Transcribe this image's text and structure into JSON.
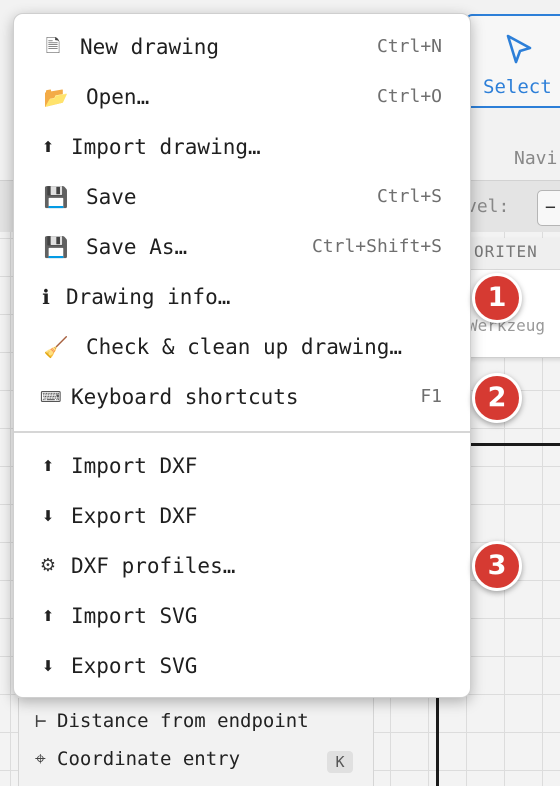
{
  "background": {
    "select_tool": {
      "label": "Select",
      "icon": "cursor-arrow-icon",
      "color": "#2d7fd8"
    },
    "navi_label": "Navi",
    "level_label": "vel:",
    "level_button": "−",
    "favorites_header": "ORITEN",
    "favorites_text": "Werkzeug",
    "bottom_panel": [
      {
        "icon": "⊢",
        "label": "Distance from endpoint",
        "key": ""
      },
      {
        "icon": "⌖",
        "label": "Coordinate entry",
        "key": "K"
      }
    ]
  },
  "badges": [
    "1",
    "2",
    "3"
  ],
  "badge_color": "#d63a32",
  "menu": {
    "group1": [
      {
        "icon": "🗎",
        "icon_name": "document-icon",
        "label": "New drawing",
        "shortcut": "Ctrl+N"
      },
      {
        "icon": "📂",
        "icon_name": "folder-open-icon",
        "label": "Open…",
        "shortcut": "Ctrl+O"
      },
      {
        "icon": "⬆",
        "icon_name": "upload-arrow-icon",
        "label": "Import drawing…",
        "shortcut": ""
      },
      {
        "icon": "💾",
        "icon_name": "floppy-disk-icon",
        "label": "Save",
        "shortcut": "Ctrl+S"
      },
      {
        "icon": "💾",
        "icon_name": "floppy-disk-icon",
        "label": "Save As…",
        "shortcut": "Ctrl+Shift+S"
      },
      {
        "icon": "ℹ",
        "icon_name": "info-icon",
        "label": "Drawing info…",
        "shortcut": ""
      },
      {
        "icon": "🧹",
        "icon_name": "broom-icon",
        "label": "Check & clean up drawing…",
        "shortcut": ""
      },
      {
        "icon": "⌨",
        "icon_name": "keyboard-icon",
        "label": "Keyboard shortcuts",
        "shortcut": "F1"
      }
    ],
    "group2": [
      {
        "icon": "⬆",
        "icon_name": "upload-arrow-icon",
        "label": "Import DXF",
        "shortcut": ""
      },
      {
        "icon": "⬇",
        "icon_name": "download-arrow-icon",
        "label": "Export DXF",
        "shortcut": ""
      },
      {
        "icon": "⚙",
        "icon_name": "gear-icon",
        "label": "DXF profiles…",
        "shortcut": ""
      },
      {
        "icon": "⬆",
        "icon_name": "upload-arrow-icon",
        "label": "Import SVG",
        "shortcut": ""
      },
      {
        "icon": "⬇",
        "icon_name": "download-arrow-icon",
        "label": "Export SVG",
        "shortcut": ""
      }
    ]
  }
}
